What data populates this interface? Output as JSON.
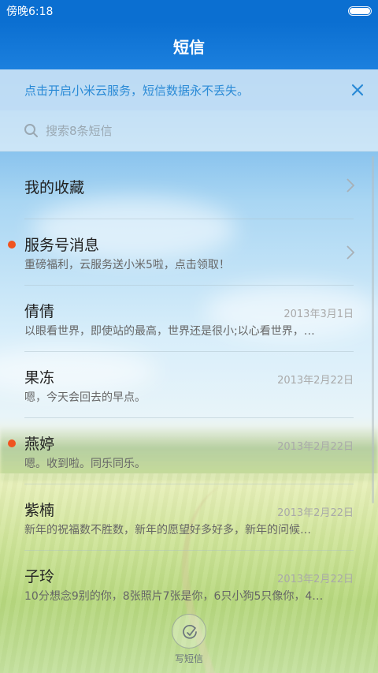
{
  "status_bar": {
    "time": "傍晚6:18"
  },
  "header": {
    "title": "短信"
  },
  "banner": {
    "text": "点击开启小米云服务，短信数据永不丢失。"
  },
  "search": {
    "placeholder": "搜索8条短信"
  },
  "favorites": {
    "label": "我的收藏"
  },
  "conversations": [
    {
      "name": "服务号消息",
      "date": "",
      "preview": "重磅福利，云服务送小米5啦，点击领取！",
      "unread": true
    },
    {
      "name": "倩倩",
      "date": "2013年3月1日",
      "preview": "以眼看世界，即使站的最高，世界还是很小;以心看世界，…",
      "unread": false
    },
    {
      "name": "果冻",
      "date": "2013年2月22日",
      "preview": "嗯，今天会回去的早点。",
      "unread": false
    },
    {
      "name": "燕婷",
      "date": "2013年2月22日",
      "preview": "嗯。收到啦。同乐同乐。",
      "unread": true
    },
    {
      "name": "紫楠",
      "date": "2013年2月22日",
      "preview": "新年的祝福数不胜数，新年的愿望好多好多，新年的问候…",
      "unread": false
    },
    {
      "name": "子玲",
      "date": "2013年2月22日",
      "preview": "10分想念9别的你，8张照片7张是你，6只小狗5只像你，4…",
      "unread": false
    }
  ],
  "compose": {
    "label": "写短信"
  },
  "colors": {
    "accent": "#0b6fd1",
    "unread": "#f0531f",
    "banner_text": "#2a8ad6"
  }
}
